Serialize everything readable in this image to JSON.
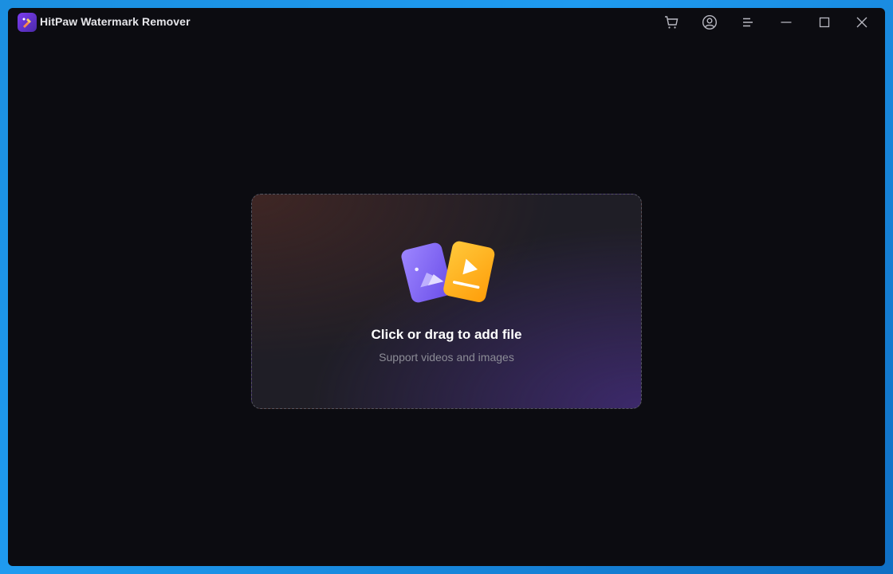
{
  "app": {
    "title": "HitPaw Watermark Remover"
  },
  "titlebar": {
    "icons": [
      "cart-icon",
      "account-icon",
      "menu-icon",
      "minimize-icon",
      "maximize-icon",
      "close-icon"
    ]
  },
  "dropzone": {
    "title": "Click or drag to add file",
    "subtitle": "Support videos and images",
    "icons": [
      "image-file-icon",
      "video-file-icon"
    ]
  },
  "colors": {
    "desktop": "#1f9bf0",
    "window_bg": "#0c0c11",
    "image_card": "#8b6cf6",
    "video_card": "#ffb31a",
    "text_primary": "#ffffff",
    "text_secondary": "#8c8c96"
  }
}
